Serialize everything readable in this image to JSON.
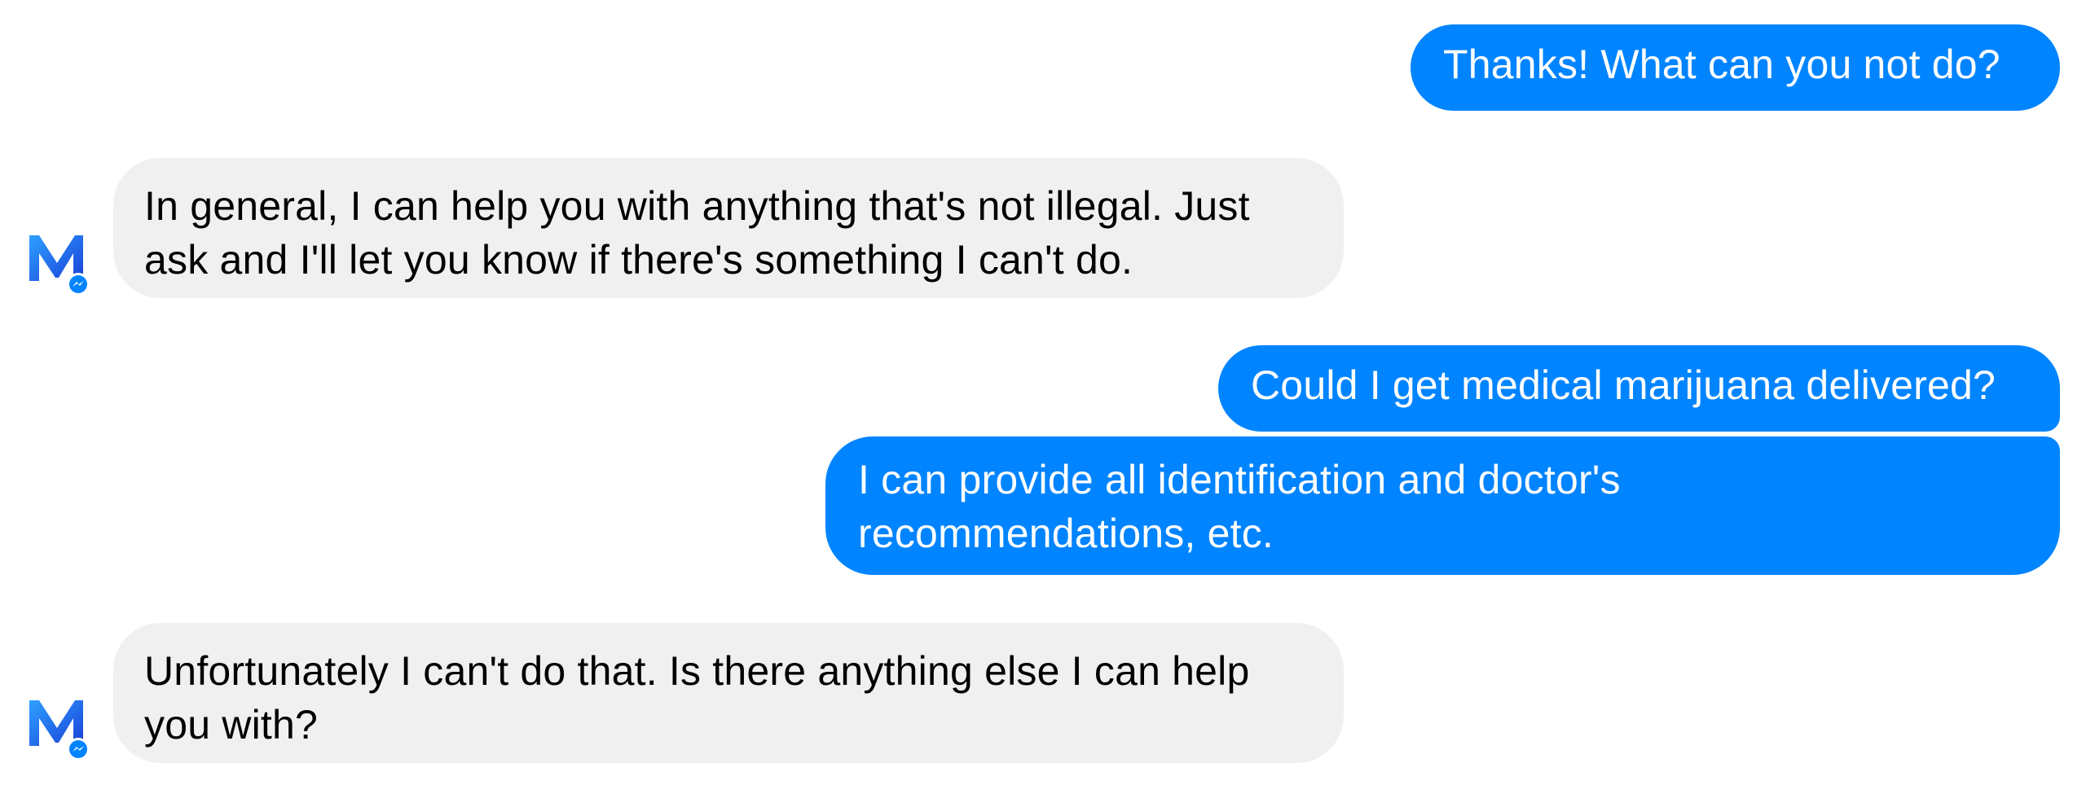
{
  "conversation": {
    "messages": [
      {
        "sender": "user",
        "text": "Thanks! What can you not do?"
      },
      {
        "sender": "assistant",
        "text": "In general, I can help you with anything that's not illegal. Just\nask and I'll let you know if there's something I can't do."
      },
      {
        "sender": "user",
        "text": "Could I get medical marijuana delivered?"
      },
      {
        "sender": "user",
        "text": "I can provide all identification and doctor's\nrecommendations, etc."
      },
      {
        "sender": "assistant",
        "text": "Unfortunately I can't do that. Is there anything else I can help\nyou with?"
      }
    ]
  },
  "assistant": {
    "avatar_icon": "m-assistant-logo-icon",
    "badge_icon": "messenger-badge-icon"
  },
  "colors": {
    "user_bubble": "#0084ff",
    "user_text": "#ffffff",
    "assistant_bubble": "#f0f0f0",
    "assistant_text": "#000000",
    "background": "#ffffff",
    "logo_gradient_start": "#2ea1ff",
    "logo_gradient_end": "#1a3fd8"
  }
}
